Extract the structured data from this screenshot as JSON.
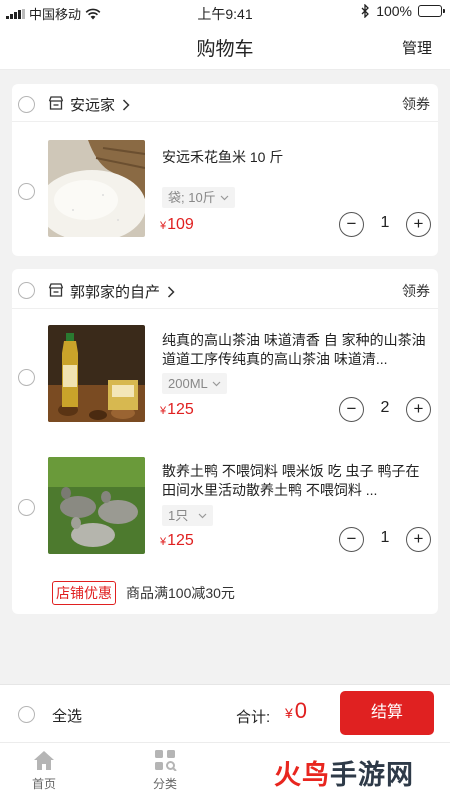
{
  "status_bar": {
    "carrier": "中国移动",
    "time": "上午9:41",
    "battery": "100%"
  },
  "nav": {
    "title": "购物车",
    "manage": "管理"
  },
  "stores": [
    {
      "name": "安远家",
      "coupon": "领券",
      "items": [
        {
          "title": "安远禾花鱼米 10 斤",
          "spec": "袋; 10斤",
          "currency": "¥",
          "price": "109",
          "quantity": "1"
        }
      ]
    },
    {
      "name": "郭郭家的自产",
      "coupon": "领券",
      "items": [
        {
          "title": "纯真的高山茶油 味道清香 自 家种的山茶油 道道工序传纯真的高山茶油 味道清...",
          "spec": "200ML",
          "currency": "¥",
          "price": "125",
          "quantity": "2"
        },
        {
          "title": "散养土鸭 不喂饲料 喂米饭 吃 虫子 鸭子在田间水里活动散养土鸭 不喂饲料 ...",
          "spec": "1只",
          "currency": "¥",
          "price": "125",
          "quantity": "1"
        }
      ],
      "promo_tag": "店铺优惠",
      "promo_text": "商品满100减30元"
    }
  ],
  "checkout": {
    "select_all": "全选",
    "total_label": "合计:",
    "currency": "¥",
    "total": "0",
    "button": "结算"
  },
  "tabs": [
    {
      "label": "首页",
      "icon": "home-icon"
    },
    {
      "label": "分类",
      "icon": "category-icon"
    }
  ],
  "watermark": {
    "part1": "火鸟",
    "part2": "手游网"
  },
  "colors": {
    "accent": "#e02020",
    "background": "#f2f2f2"
  }
}
